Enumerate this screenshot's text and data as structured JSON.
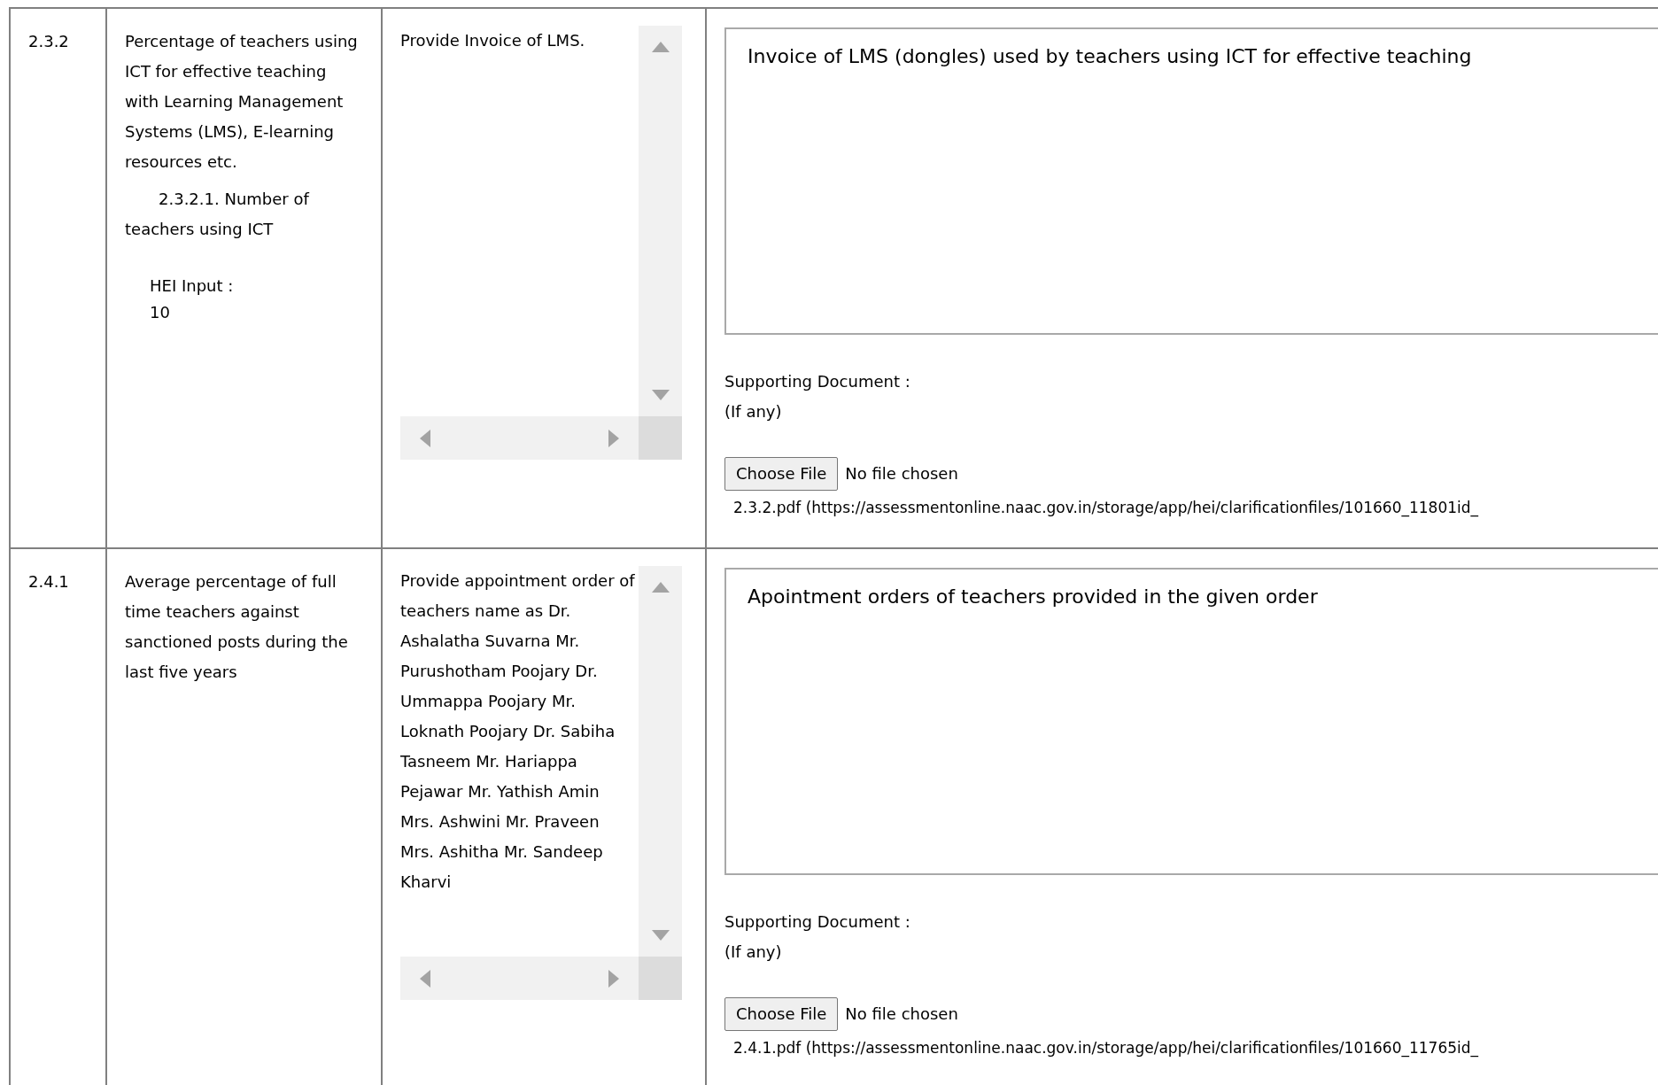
{
  "rows": [
    {
      "number": "2.3.2",
      "metric": "Percentage of teachers using ICT for effective teaching with Learning Management Systems (LMS), E-learning resources etc.",
      "sub_metric": "2.3.2.1. Number of teachers using ICT",
      "hei_input_label": "HEI Input :",
      "hei_input_value": "10",
      "requirement": "Provide Invoice of LMS.",
      "response": "Invoice of LMS (dongles) used by teachers using ICT for effective teaching",
      "supporting_label": "Supporting Document :",
      "supporting_hint": "(If any)",
      "file_button": "Choose File",
      "file_status": "No file chosen",
      "file_link": "2.3.2.pdf (https://assessmentonline.naac.gov.in/storage/app/hei/clarificationfiles/101660_11801id_"
    },
    {
      "number": "2.4.1",
      "metric": "Average percentage of full time teachers against sanctioned posts during the last five years",
      "requirement": "Provide appointment order of teachers name as Dr. Ashalatha Suvarna Mr. Purushotham Poojary Dr. Ummappa Poojary Mr. Loknath Poojary Dr. Sabiha Tasneem Mr. Hariappa Pejawar Mr. Yathish Amin Mrs. Ashwini Mr. Praveen Mrs. Ashitha Mr. Sandeep Kharvi",
      "response": "Apointment orders of teachers provided in the given order",
      "supporting_label": "Supporting Document :",
      "supporting_hint": "(If any)",
      "file_button": "Choose File",
      "file_status": "No file chosen",
      "file_link": "2.4.1.pdf (https://assessmentonline.naac.gov.in/storage/app/hei/clarificationfiles/101660_11765id_"
    }
  ]
}
